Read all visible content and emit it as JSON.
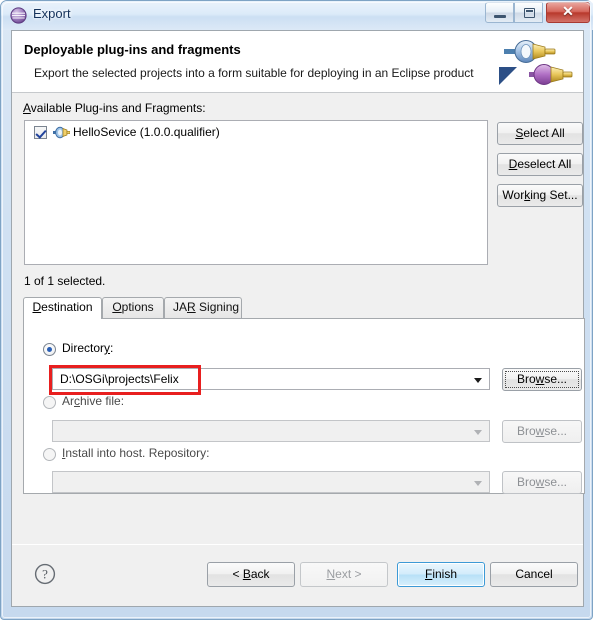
{
  "window": {
    "title": "Export",
    "icon": "eclipse-sphere-icon",
    "controls": {
      "minimize": "minimize-icon",
      "maximize": "maximize-icon",
      "close": "✕"
    }
  },
  "header": {
    "title": "Deployable plug-ins and fragments",
    "description": "Export the selected projects into a form suitable for deploying in an Eclipse product",
    "artwork": "plug-connectors-icon"
  },
  "body": {
    "available_label": "Available Plug-ins and Fragments:",
    "available_label_mnemonic": "A",
    "plugins": [
      {
        "label": "HelloSevice (1.0.0.qualifier)",
        "checked": true,
        "icon": "plugin-icon"
      }
    ],
    "selected_count": "1 of 1 selected.",
    "side_buttons": [
      {
        "label": "Select All",
        "mnemonic": "S"
      },
      {
        "label": "Deselect All",
        "mnemonic": "D"
      },
      {
        "label": "Working Set...",
        "mnemonic": "k"
      }
    ]
  },
  "tabs": [
    {
      "label": "Destination",
      "mnemonic": "D",
      "active": true
    },
    {
      "label": "Options",
      "mnemonic": "O",
      "active": false
    },
    {
      "label": "JAR Signing",
      "mnemonic": "R",
      "active": false
    }
  ],
  "destination": {
    "directory": {
      "label": "Directory:",
      "selected": true,
      "value": "D:\\OSGi\\projects\\Felix",
      "browse_label": "Browse...",
      "browse_enabled": true,
      "browse_focused": true,
      "highlighted": true
    },
    "archive": {
      "label": "Archive file:",
      "selected": false,
      "value": "",
      "browse_label": "Browse...",
      "browse_enabled": false
    },
    "install_host": {
      "label": "Install into host. Repository:",
      "selected": false,
      "value": "",
      "browse_label": "Browse...",
      "browse_enabled": false
    }
  },
  "footer": {
    "help": "?",
    "buttons": [
      {
        "label": "< Back",
        "enabled": true,
        "default": false
      },
      {
        "label": "Next >",
        "enabled": false,
        "default": false
      },
      {
        "label": "Finish",
        "enabled": true,
        "default": true
      },
      {
        "label": "Cancel",
        "enabled": true,
        "default": false
      }
    ]
  },
  "colors": {
    "annotation": "#e81f1f",
    "default_button_border": "#3c9ad6",
    "title_text": "#15325b"
  }
}
